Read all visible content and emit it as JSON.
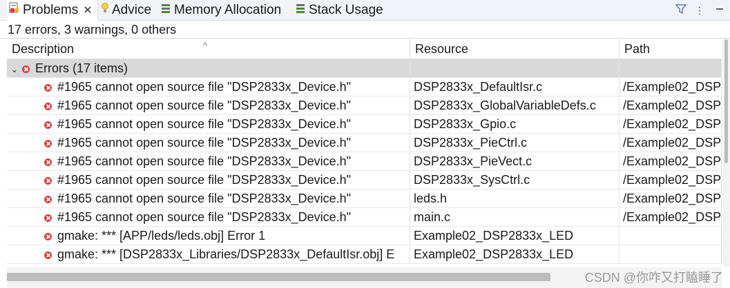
{
  "tabs": [
    {
      "label": "Problems",
      "icon": "problems-icon",
      "active": true
    },
    {
      "label": "Advice",
      "icon": "lightbulb-icon"
    },
    {
      "label": "Memory Allocation",
      "icon": "memory-allocation-icon"
    },
    {
      "label": "Stack Usage",
      "icon": "stack-usage-icon"
    }
  ],
  "summary": "17 errors, 3 warnings, 0 others",
  "columns": {
    "description": "Description",
    "resource": "Resource",
    "path": "Path"
  },
  "group": {
    "label": "Errors (17 items)"
  },
  "rows": [
    {
      "desc": "#1965 cannot open source file \"DSP2833x_Device.h\"",
      "res": "DSP2833x_DefaultIsr.c",
      "path": "/Example02_DSP"
    },
    {
      "desc": "#1965 cannot open source file \"DSP2833x_Device.h\"",
      "res": "DSP2833x_GlobalVariableDefs.c",
      "path": "/Example02_DSP"
    },
    {
      "desc": "#1965 cannot open source file \"DSP2833x_Device.h\"",
      "res": "DSP2833x_Gpio.c",
      "path": "/Example02_DSP"
    },
    {
      "desc": "#1965 cannot open source file \"DSP2833x_Device.h\"",
      "res": "DSP2833x_PieCtrl.c",
      "path": "/Example02_DSP"
    },
    {
      "desc": "#1965 cannot open source file \"DSP2833x_Device.h\"",
      "res": "DSP2833x_PieVect.c",
      "path": "/Example02_DSP"
    },
    {
      "desc": "#1965 cannot open source file \"DSP2833x_Device.h\"",
      "res": "DSP2833x_SysCtrl.c",
      "path": "/Example02_DSP"
    },
    {
      "desc": "#1965 cannot open source file \"DSP2833x_Device.h\"",
      "res": "leds.h",
      "path": "/Example02_DSP"
    },
    {
      "desc": "#1965 cannot open source file \"DSP2833x_Device.h\"",
      "res": "main.c",
      "path": "/Example02_DSP"
    },
    {
      "desc": "gmake: *** [APP/leds/leds.obj] Error 1",
      "res": "Example02_DSP2833x_LED",
      "path": ""
    },
    {
      "desc": "gmake: *** [DSP2833x_Libraries/DSP2833x_DefaultIsr.obj] E",
      "res": "Example02_DSP2833x_LED",
      "path": ""
    }
  ],
  "watermark": "CSDN @你咋又打瞌睡了",
  "colors": {
    "error": "#d93b3b",
    "group_bg": "#d9d9d9",
    "tabbar_bg": "#f1f3f8"
  }
}
